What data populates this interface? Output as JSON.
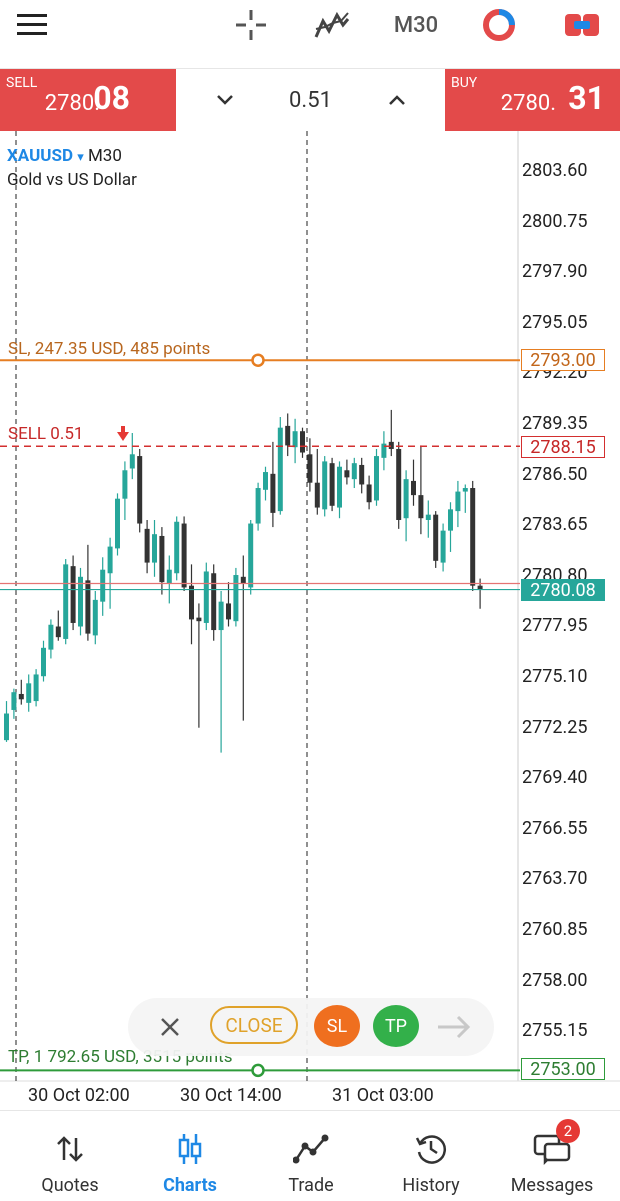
{
  "top": {
    "timeframe": "M30"
  },
  "trade": {
    "sell_label": "SELL",
    "sell_price_small": "2780.",
    "sell_price_big": "08",
    "buy_label": "BUY",
    "buy_price_small": "2780.",
    "buy_price_big": "31",
    "volume": "0.51"
  },
  "chart": {
    "symbol": "XAUUSD",
    "symbol_arrow": "▾",
    "timeframe": "M30",
    "description": "Gold vs US Dollar",
    "sl_label": "SL, 247.35 USD, 485 points",
    "sl_tag": "2793.00",
    "sell_label": "SELL 0.51",
    "sell_tag": "2788.15",
    "bid_tag": "2780.08",
    "tp_label": "TP, 1 792.65 USD, 3515 points",
    "tp_tag": "2753.00",
    "price_labels": [
      "2803.60",
      "2800.75",
      "2797.90",
      "2795.05",
      "2792.20",
      "2789.35",
      "2786.50",
      "2783.65",
      "2780.80",
      "2777.95",
      "2775.10",
      "2772.25",
      "2769.40",
      "2766.55",
      "2763.70",
      "2760.85",
      "2758.00",
      "2755.15"
    ],
    "time_labels": [
      "30 Oct 02:00",
      "30 Oct 14:00",
      "31 Oct 03:00"
    ],
    "colors": {
      "bull": "#26a69a",
      "bear": "#333333",
      "sl": "#e67e22",
      "sell": "#d32f2f",
      "bid": "#26a69a",
      "tp": "#2e9b3a"
    }
  },
  "float_bar": {
    "close_label": "CLOSE",
    "sl_label": "SL",
    "tp_label": "TP"
  },
  "nav": {
    "items": [
      {
        "label": "Quotes",
        "icon": "quotes-icon"
      },
      {
        "label": "Charts",
        "icon": "charts-icon"
      },
      {
        "label": "Trade",
        "icon": "trade-icon"
      },
      {
        "label": "History",
        "icon": "history-icon"
      },
      {
        "label": "Messages",
        "icon": "messages-icon"
      }
    ],
    "messages_badge": "2"
  }
}
